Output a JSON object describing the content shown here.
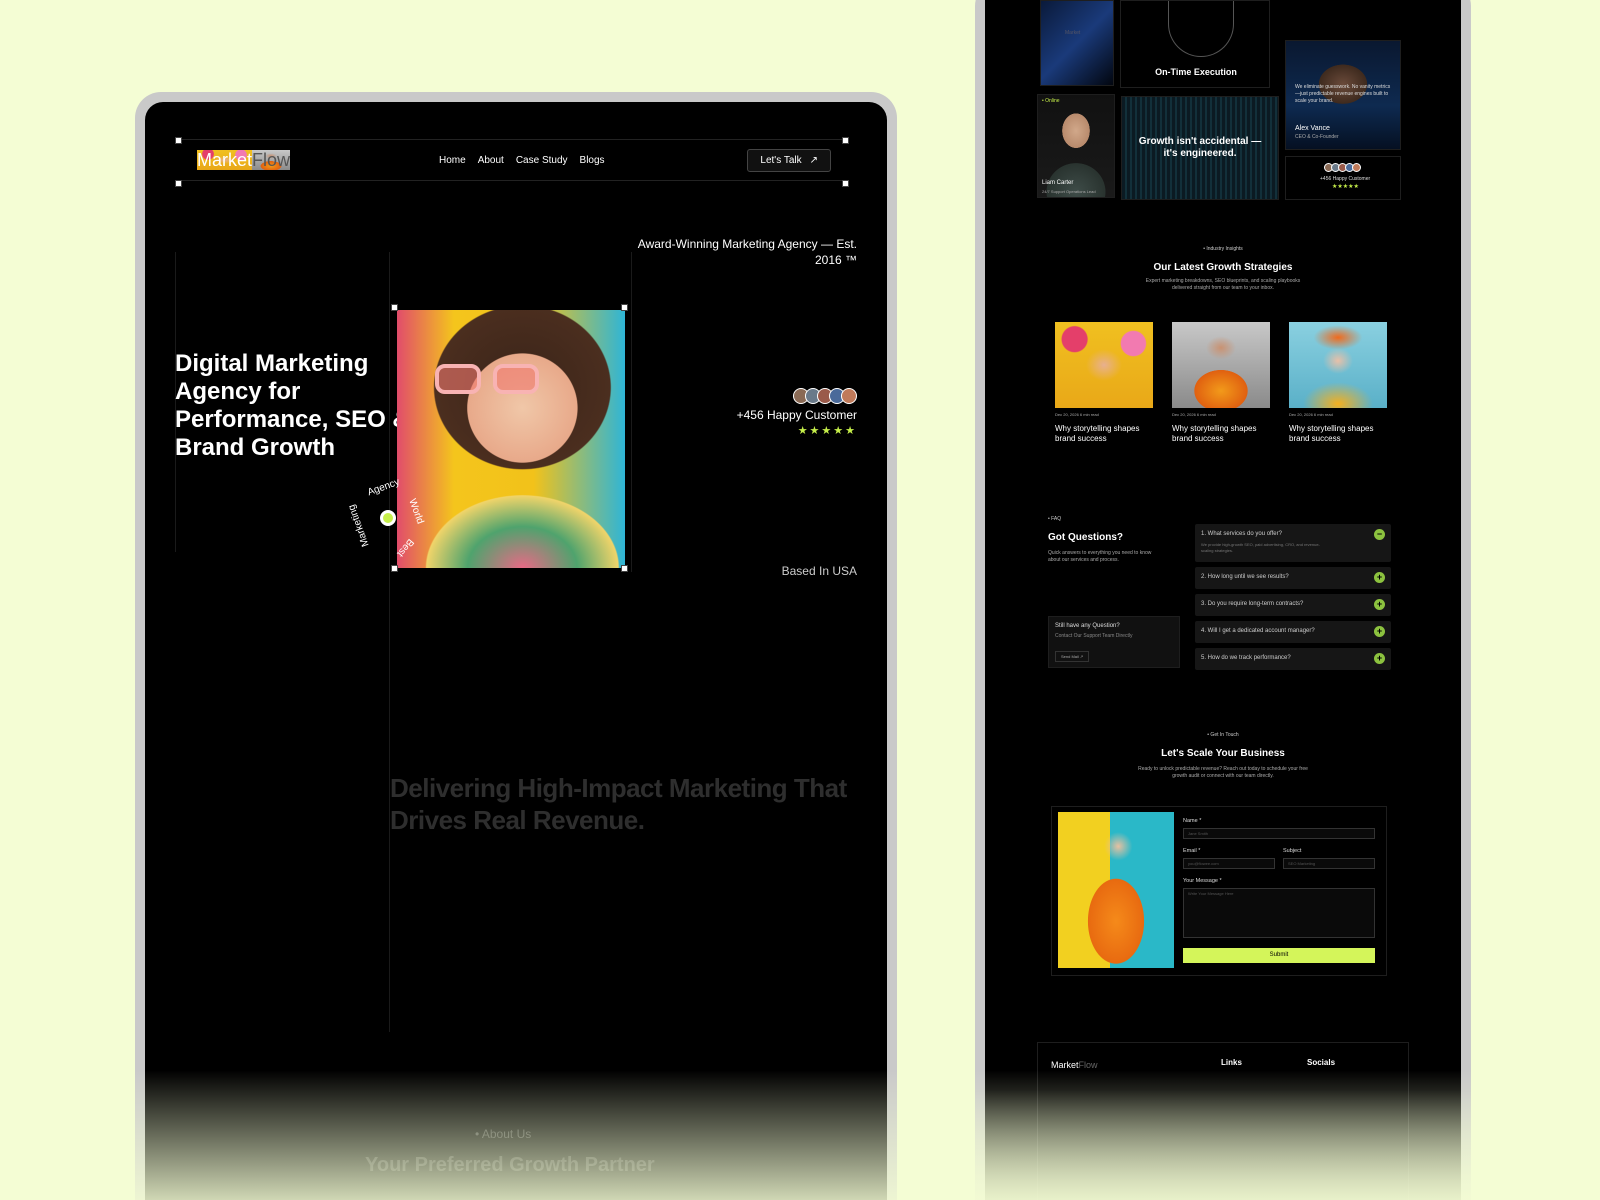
{
  "left": {
    "brand": {
      "part1": "Market",
      "part2": "Flow"
    },
    "nav": {
      "home": "Home",
      "about": "About",
      "case_study": "Case Study",
      "blogs": "Blogs",
      "cta": "Let's Talk",
      "cta_arrow": "↗"
    },
    "award": "Award-Winning Marketing Agency — Est. 2016 ™",
    "hero_title": "Digital Marketing Agency for Performance, SEO & Brand Growth",
    "circle_words": {
      "agency": "Agency",
      "world": "World",
      "best": "Best",
      "marketing": "Marketing"
    },
    "happy_customers": "+456 Happy Customer",
    "stars": "★★★★★",
    "based": "Based In USA",
    "tagline": "Delivering High-Impact Marketing That Drives Real Revenue.",
    "about_chip": "• About Us",
    "strategy_heading": "Your Preferred Growth Partner"
  },
  "right": {
    "market_label": "Market",
    "on_time": "On-Time Execution",
    "online": "• Online",
    "person_name": "Liam Carter",
    "person_role": "24/7 Support Operations Lead",
    "growth_quote": "Growth isn't accidental —it's engineered.",
    "testimonial": "We eliminate guesswork. No vanity metrics—just predictable revenue engines built to scale your brand.",
    "alex_name": "Alex Vance",
    "alex_role": "CEO & Co-Founder",
    "happy_small": "+456 Happy Customer",
    "stars_small": "★★★★★",
    "insights_chip": "• Industry Insights",
    "insights_title": "Our Latest Growth Strategies",
    "insights_sub": "Expert marketing breakdowns, SEO blueprints, and scaling playbooks delivered straight from our team to your inbox.",
    "blogs": [
      {
        "meta": "Dec 20, 2026   6 min read",
        "title": "Why storytelling shapes brand success"
      },
      {
        "meta": "Dec 20, 2026   6 min read",
        "title": "Why storytelling shapes brand success"
      },
      {
        "meta": "Dec 20, 2026   6 min read",
        "title": "Why storytelling shapes brand success"
      }
    ],
    "faq_chip": "• FAQ",
    "faq_title": "Got Questions?",
    "faq_sub": "Quick answers to everything you need to know about our services and process.",
    "faq_still": "Still have any Question?",
    "faq_contact": "Contact Our Support Team Directly",
    "faq_send": "Send Mail ↗",
    "faq_items": [
      {
        "q": "1. What services do you offer?",
        "a": "We provide high-growth SEO, paid advertising, CRO, and revenue-scaling strategies.",
        "icon": "−"
      },
      {
        "q": "2. How long until we see results?",
        "icon": "+"
      },
      {
        "q": "3. Do you require long-term contracts?",
        "icon": "+"
      },
      {
        "q": "4. Will I get a dedicated account manager?",
        "icon": "+"
      },
      {
        "q": "5. How do we track performance?",
        "icon": "+"
      }
    ],
    "contact_chip": "• Get In Touch",
    "contact_title": "Let's Scale Your Business",
    "contact_sub": "Ready to unlock predictable revenue? Reach out today to schedule your free growth audit or connect with our team directly.",
    "form": {
      "name_label": "Name *",
      "name_ph": "Jane Smith",
      "email_label": "Email *",
      "email_ph": "you@flowee.com",
      "subject_label": "Subject",
      "subject_ph": "SEO Marketing",
      "message_label": "Your Message *",
      "message_ph": "Write Your Message Here",
      "submit": "Submit"
    },
    "footer": {
      "brand1": "Market",
      "brand2": "Flow",
      "links": "Links",
      "socials": "Socials"
    }
  }
}
